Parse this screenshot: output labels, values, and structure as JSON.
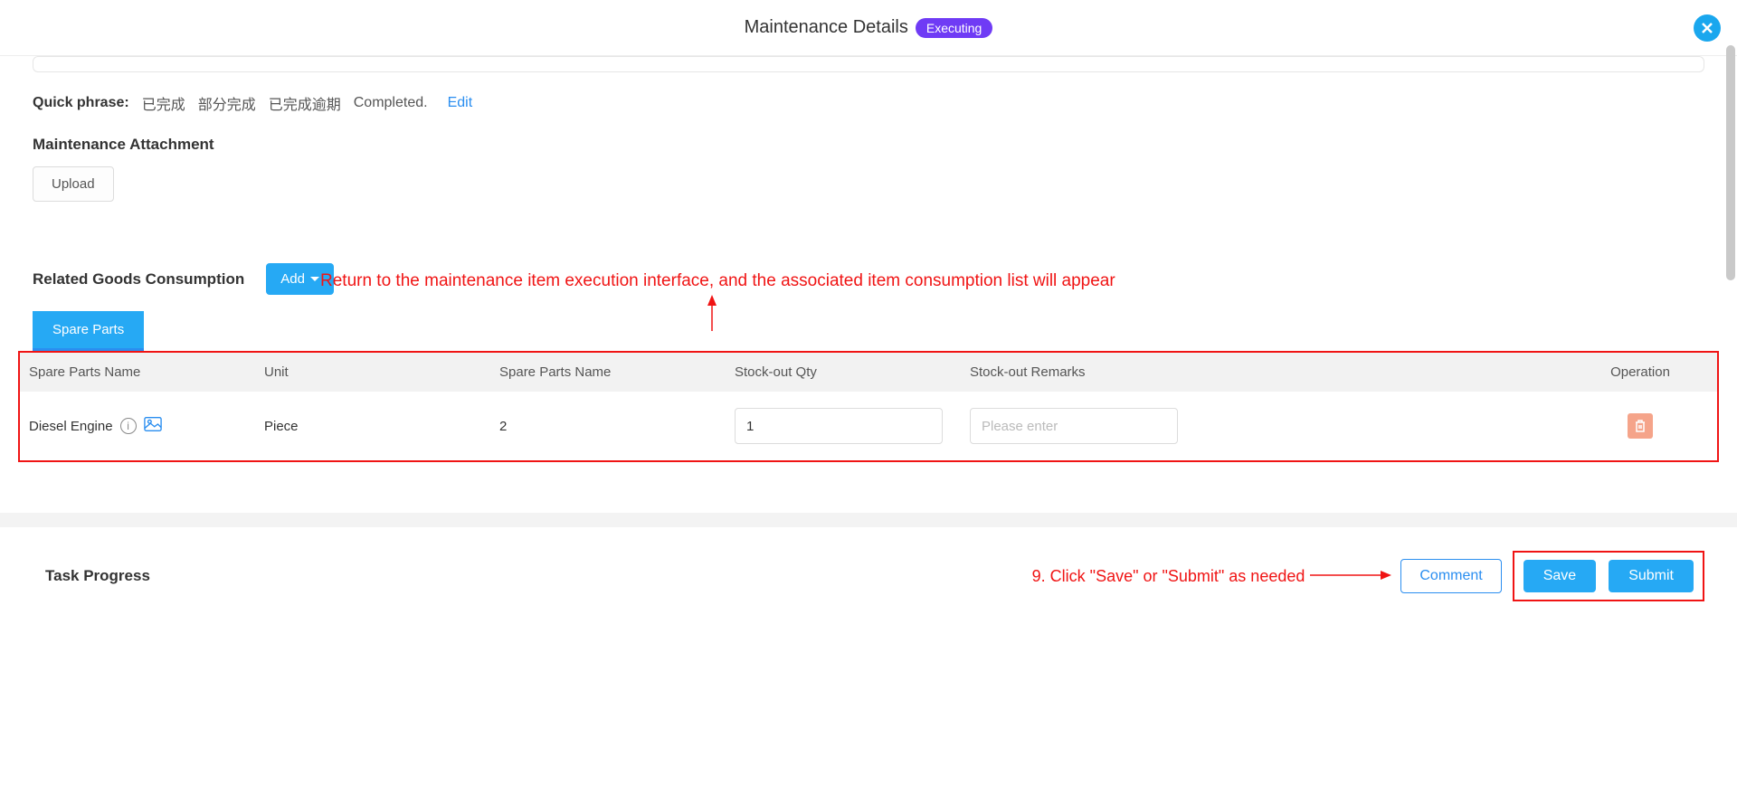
{
  "header": {
    "title": "Maintenance Details",
    "status": "Executing"
  },
  "quick_phrase": {
    "label": "Quick phrase:",
    "items": [
      "已完成",
      "部分完成",
      "已完成逾期",
      "Completed."
    ],
    "edit": "Edit"
  },
  "attachment": {
    "heading": "Maintenance Attachment",
    "upload": "Upload"
  },
  "related": {
    "heading": "Related Goods Consumption",
    "add": "Add",
    "tab_spare_parts": "Spare Parts"
  },
  "table": {
    "headers": {
      "name": "Spare Parts Name",
      "unit": "Unit",
      "spn2": "Spare Parts Name",
      "qty": "Stock-out Qty",
      "remarks": "Stock-out Remarks",
      "operation": "Operation"
    },
    "rows": [
      {
        "name": "Diesel Engine",
        "unit": "Piece",
        "spn2": "2",
        "qty": "1",
        "remarks_placeholder": "Please enter"
      }
    ]
  },
  "footer": {
    "task_progress": "Task Progress",
    "comment": "Comment",
    "save": "Save",
    "submit": "Submit"
  },
  "annotations": {
    "a1": "Return to the maintenance item execution interface, and the associated item consumption list will appear",
    "a2": "9. Click \"Save\" or \"Submit\" as needed"
  }
}
